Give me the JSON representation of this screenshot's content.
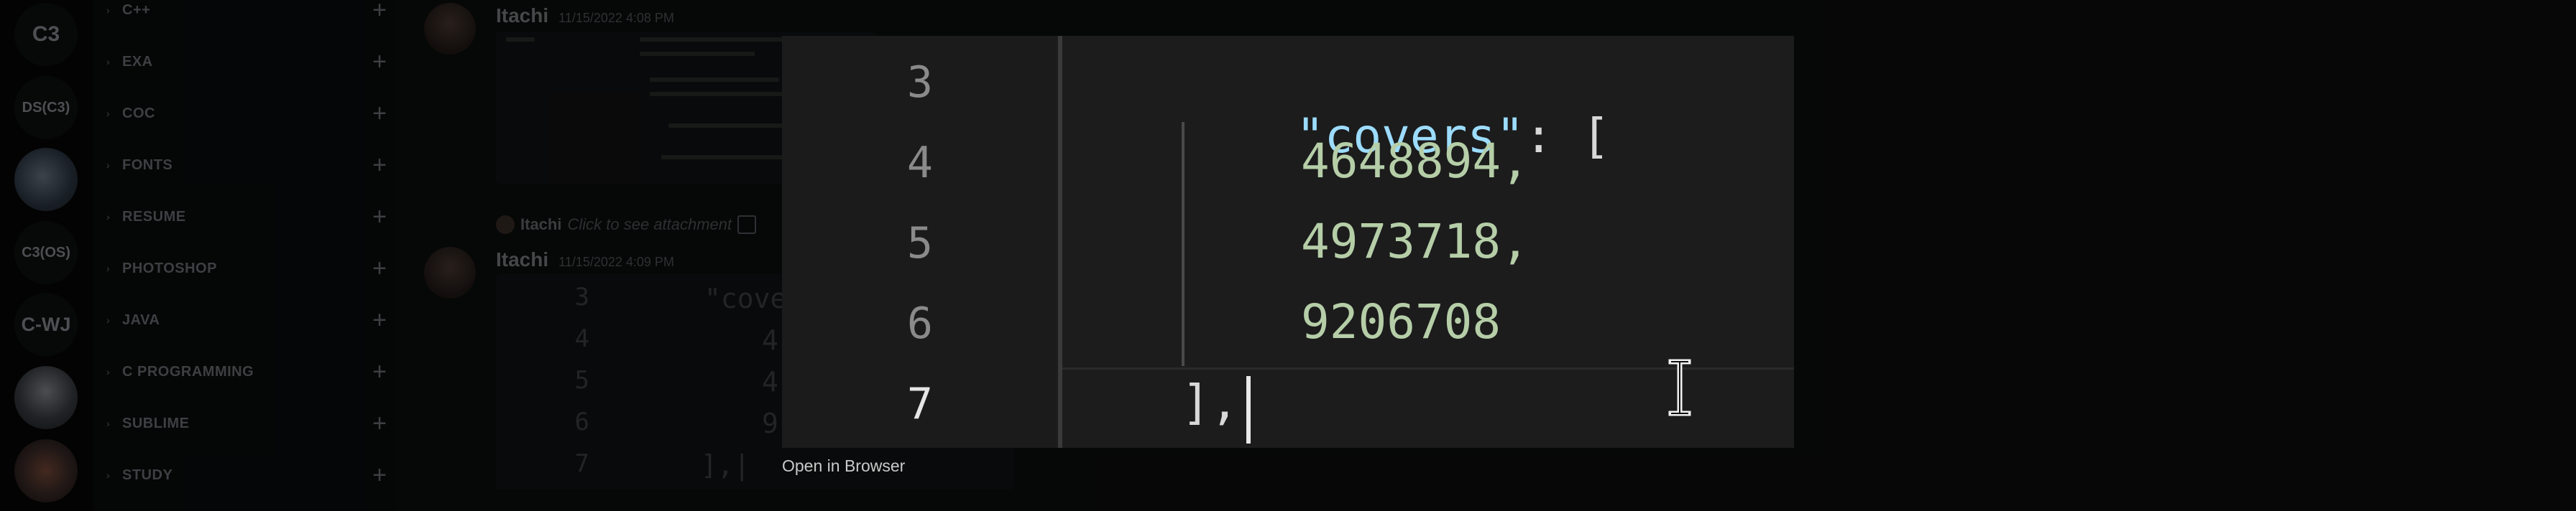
{
  "servers": [
    {
      "label": "C3"
    },
    {
      "label": "DS(C3)"
    },
    {
      "label": ""
    },
    {
      "label": "C3(OS)"
    },
    {
      "label": "C-WJ"
    },
    {
      "label": ""
    },
    {
      "label": ""
    }
  ],
  "channels": [
    {
      "name": "C++"
    },
    {
      "name": "EXA"
    },
    {
      "name": "COC"
    },
    {
      "name": "FONTS"
    },
    {
      "name": "RESUME"
    },
    {
      "name": "PHOTOSHOP"
    },
    {
      "name": "JAVA"
    },
    {
      "name": "C PROGRAMMING"
    },
    {
      "name": "SUBLIME"
    },
    {
      "name": "STUDY"
    }
  ],
  "messages": [
    {
      "user": "Itachi",
      "time": "11/15/2022 4:08 PM"
    },
    {
      "user": "Itachi",
      "time": "11/15/2022 4:09 PM"
    }
  ],
  "reply": {
    "user": "Itachi",
    "text": "Click to see attachment"
  },
  "viewer": {
    "line_numbers": [
      "3",
      "4",
      "5",
      "6",
      "7"
    ],
    "code": {
      "line3_key": "\"covers\"",
      "line3_rest": ": [",
      "line4": "4648894,",
      "line5": "4973718,",
      "line6": "9206708",
      "line7": "],"
    },
    "open_in_browser": "Open in Browser"
  },
  "thumb_code": {
    "line_numbers": [
      "3",
      "4",
      "5",
      "6",
      "7"
    ],
    "line3": "\"cove",
    "line4": "4",
    "line5": "4",
    "line6": "9",
    "line7": "],|"
  },
  "colors": {
    "key": "#9cdcfe",
    "number": "#b5cea8",
    "background": "#1c1c1c"
  }
}
